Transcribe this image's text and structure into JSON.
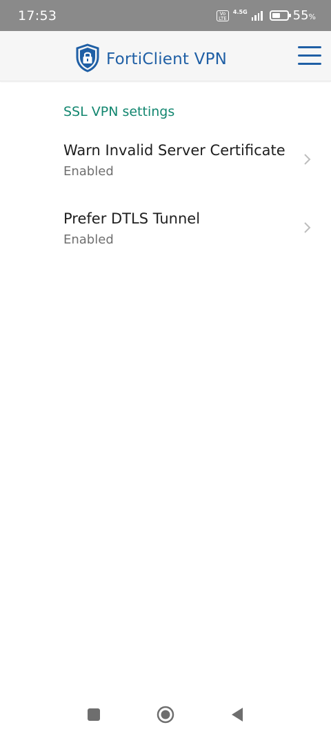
{
  "status_bar": {
    "time": "17:53",
    "volte_label": "Vo\nLTE",
    "network_type": "4.5G",
    "battery_percent_number": "55",
    "battery_percent_sign": "%",
    "battery_level": 0.55
  },
  "header": {
    "title": "FortiClient VPN",
    "brand_color": "#1f5fa5",
    "icons": {
      "logo": "shield-lock-icon",
      "menu": "hamburger-menu-icon"
    }
  },
  "section": {
    "title": "SSL VPN settings",
    "accent_color": "#12866f"
  },
  "settings": [
    {
      "title": "Warn Invalid Server Certificate",
      "status": "Enabled"
    },
    {
      "title": "Prefer DTLS Tunnel",
      "status": "Enabled"
    }
  ],
  "nav_bar": {
    "icons": [
      "recent-apps-icon",
      "home-icon",
      "back-icon"
    ]
  }
}
